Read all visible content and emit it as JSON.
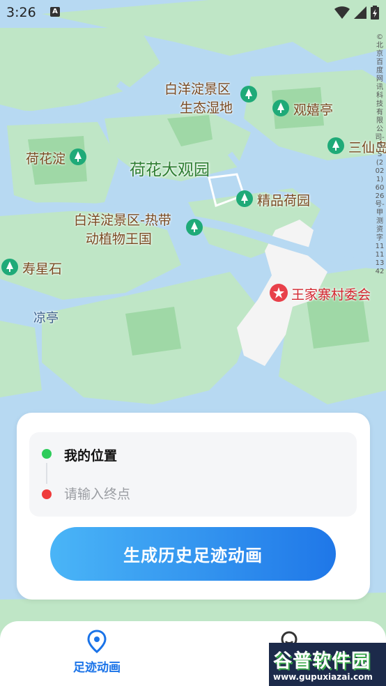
{
  "status_bar": {
    "time": "3:26",
    "notification_icon": "A"
  },
  "map": {
    "labels": {
      "baiyangdian_wetland_line1": "白洋淀景区",
      "baiyangdian_wetland_line2": "生态湿地",
      "guanxiting": "观嬉亭",
      "sanxian": "三仙岛",
      "hehuadian": "荷花淀",
      "hehua_daguanyuan": "荷花大观园",
      "jingpin_heyuan": "精品荷园",
      "tropical_line1": "白洋淀景区-热带",
      "tropical_line2": "动植物王国",
      "shouxingshi": "寿星石",
      "liangting": "凉亭",
      "wangjiazhai": "王家寨村委会"
    },
    "copyright": "©北京百度网讯科技有限公司-GS(2021)6026号-甲测资字11111342",
    "colors": {
      "water": "#b7d9f2",
      "land": "#bfe6c6",
      "green_block": "#9fd8a6",
      "village": "#f4f4f4",
      "poi_pin": "#1faa78",
      "gov_pin": "#e8404a"
    }
  },
  "route_card": {
    "start_label": "我的位置",
    "end_placeholder": "请输入终点",
    "generate_button": "生成历史足迹动画"
  },
  "tabbar": {
    "tabs": [
      {
        "label": "足迹动画",
        "icon": "location-pin-icon",
        "active": true
      },
      {
        "label": "",
        "icon": "user-icon",
        "active": false
      }
    ]
  },
  "watermark": {
    "line1": "谷普软件园",
    "line2": "www.gupuxiazai.com"
  }
}
